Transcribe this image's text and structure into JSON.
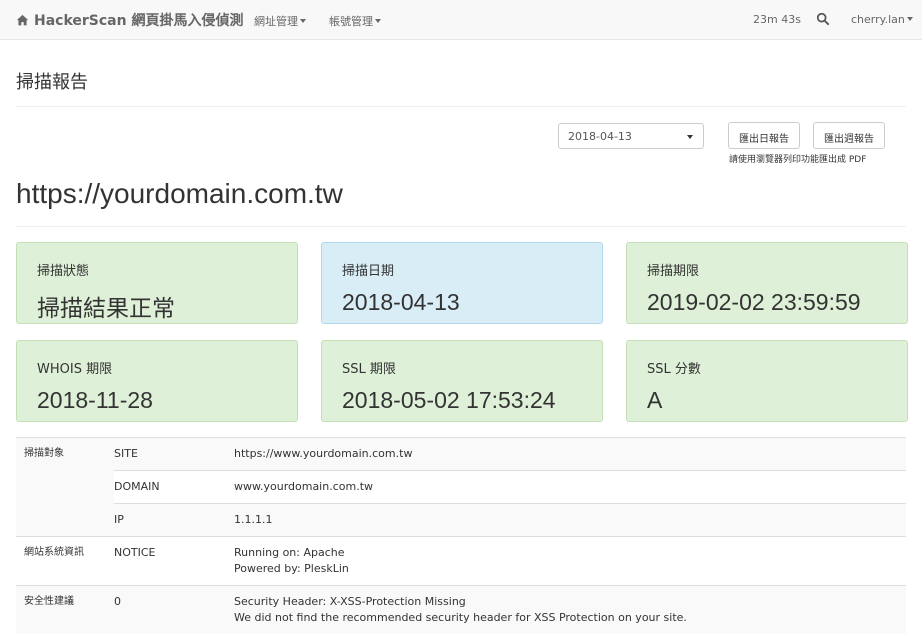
{
  "navbar": {
    "brand": "HackerScan 網頁掛馬入侵偵測",
    "brand_icon": "home-icon",
    "menu_urls": "網址管理",
    "menu_accounts": "帳號管理",
    "timer": "23m 43s",
    "search_icon": "search-icon",
    "user": "cherry.lan"
  },
  "page": {
    "title": "掃描報告",
    "date_selected": "2018-04-13",
    "export_daily": "匯出日報告",
    "export_weekly": "匯出週報告",
    "export_hint": "請使用瀏覽器列印功能匯出成 PDF",
    "domain": "https://yourdomain.com.tw"
  },
  "cards": [
    {
      "label": "掃描狀態",
      "value": "掃描結果正常",
      "color": "#dff0d8"
    },
    {
      "label": "掃描日期",
      "value": "2018-04-13",
      "color": "#d9edf7"
    },
    {
      "label": "掃描期限",
      "value": "2019-02-02 23:59:59",
      "color": "#dff0d8"
    },
    {
      "label": "WHOIS 期限",
      "value": "2018-11-28",
      "color": "#dff0d8"
    },
    {
      "label": "SSL 期限",
      "value": "2018-05-02 17:53:24",
      "color": "#dff0d8"
    },
    {
      "label": "SSL 分數",
      "value": "A",
      "color": "#dff0d8"
    }
  ],
  "details": {
    "scan_target_label": "掃描對象",
    "site_key": "SITE",
    "site_value": "https://www.yourdomain.com.tw",
    "domain_key": "DOMAIN",
    "domain_value": "www.yourdomain.com.tw",
    "ip_key": "IP",
    "ip_value": "1.1.1.1",
    "sysinfo_label": "網站系統資訊",
    "notice_key": "NOTICE",
    "notice_line1": "Running on: Apache",
    "notice_line2": "Powered by: PleskLin",
    "security_label": "安全性建議",
    "security_key": "0",
    "security_line1": "Security Header: X-XSS-Protection Missing",
    "security_line2": "We did not find the recommended security header for XSS Protection on your site."
  }
}
